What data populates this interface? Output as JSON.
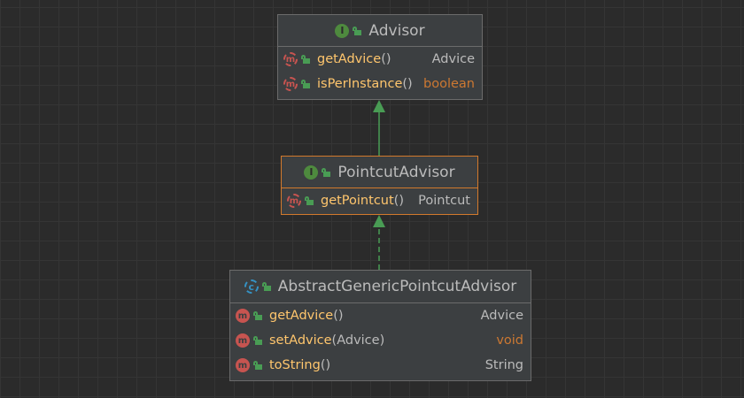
{
  "colors": {
    "background": "#2b2b2b",
    "node_fill": "#3c3f41",
    "node_border": "#6b6b6b",
    "selected_border": "#d2792c",
    "method_name": "#ffc66d",
    "keyword_type": "#cc7832",
    "edge": "#499c54"
  },
  "nodes": {
    "advisor": {
      "kind": "interface",
      "title": "Advisor",
      "methods": [
        {
          "name": "getAdvice",
          "params": "()",
          "return_type": "Advice",
          "abstract": true
        },
        {
          "name": "isPerInstance",
          "params": "()",
          "return_type": "boolean",
          "abstract": true
        }
      ]
    },
    "pointcut_advisor": {
      "kind": "interface",
      "title": "PointcutAdvisor",
      "selected": true,
      "methods": [
        {
          "name": "getPointcut",
          "params": "()",
          "return_type": "Pointcut",
          "abstract": true
        }
      ]
    },
    "abstract_generic": {
      "kind": "abstract-class",
      "title": "AbstractGenericPointcutAdvisor",
      "methods": [
        {
          "name": "getAdvice",
          "params": "()",
          "return_type": "Advice"
        },
        {
          "name": "setAdvice",
          "params": "(Advice)",
          "return_type": "void"
        },
        {
          "name": "toString",
          "params": "()",
          "return_type": "String"
        }
      ]
    }
  },
  "edges": [
    {
      "from": "pointcut_advisor",
      "to": "advisor",
      "style": "solid",
      "relation": "extends"
    },
    {
      "from": "abstract_generic",
      "to": "pointcut_advisor",
      "style": "dashed",
      "relation": "implements"
    }
  ],
  "icons": {
    "interface": "interface-icon",
    "abstract_class": "abstract-class-icon",
    "method": "method-icon",
    "abstract_method": "abstract-method-icon",
    "public": "public-lock-icon"
  }
}
